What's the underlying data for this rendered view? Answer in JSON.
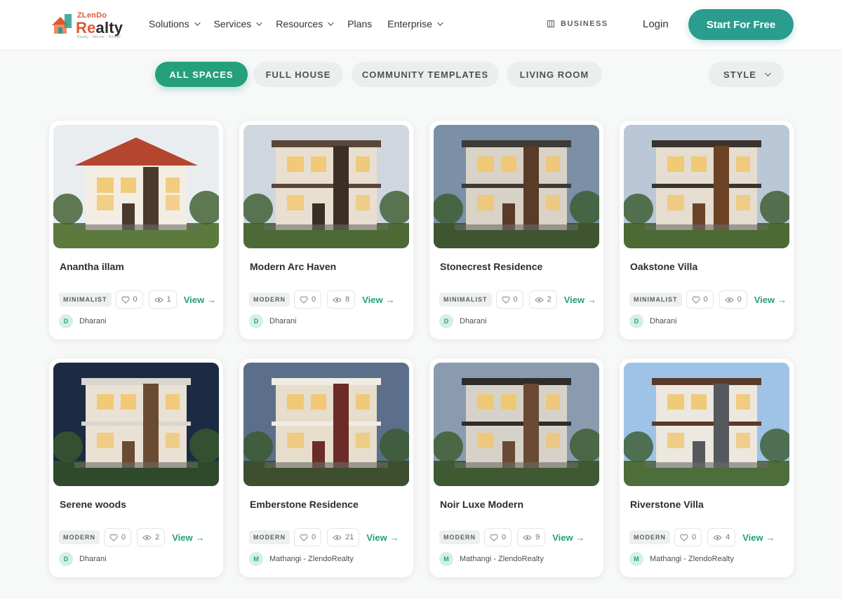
{
  "brand": {
    "top": "ZLenDo",
    "main_a": "Re",
    "main_b": "alty",
    "tag": "Realty · Interior · Builder"
  },
  "nav": [
    {
      "label": "Solutions",
      "has_menu": true
    },
    {
      "label": "Services",
      "has_menu": true
    },
    {
      "label": "Resources",
      "has_menu": true
    },
    {
      "label": "Plans",
      "has_menu": false
    },
    {
      "label": "Enterprise",
      "has_menu": true
    }
  ],
  "header": {
    "business": "BUSINESS",
    "login": "Login",
    "cta": "Start For Free"
  },
  "filters": {
    "chips": [
      "ALL SPACES",
      "FULL HOUSE",
      "COMMUNITY TEMPLATES",
      "LIVING ROOM"
    ],
    "active": "ALL SPACES",
    "style": "STYLE"
  },
  "view_label": "View",
  "colors": {
    "accent": "#24a07a",
    "cta": "#2a9d8f",
    "brand": "#e4572e"
  },
  "cards": [
    {
      "title": "Anantha illam",
      "tag": "MINIMALIST",
      "likes": "0",
      "views": "1",
      "author": "Dharani",
      "initial": "D"
    },
    {
      "title": "Modern Arc Haven",
      "tag": "MODERN",
      "likes": "0",
      "views": "8",
      "author": "Dharani",
      "initial": "D"
    },
    {
      "title": "Stonecrest Residence",
      "tag": "MINIMALIST",
      "likes": "0",
      "views": "2",
      "author": "Dharani",
      "initial": "D"
    },
    {
      "title": "Oakstone Villa",
      "tag": "MINIMALIST",
      "likes": "0",
      "views": "0",
      "author": "Dharani",
      "initial": "D"
    },
    {
      "title": "Serene woods",
      "tag": "MODERN",
      "likes": "0",
      "views": "2",
      "author": "Dharani",
      "initial": "D"
    },
    {
      "title": "Emberstone Residence",
      "tag": "MODERN",
      "likes": "0",
      "views": "21",
      "author": "Mathangi - ZlendoRealty",
      "initial": "M"
    },
    {
      "title": "Noir Luxe Modern",
      "tag": "MODERN",
      "likes": "0",
      "views": "9",
      "author": "Mathangi - ZlendoRealty",
      "initial": "M"
    },
    {
      "title": "Riverstone Villa",
      "tag": "MODERN",
      "likes": "0",
      "views": "4",
      "author": "Mathangi - ZlendoRealty",
      "initial": "M"
    }
  ]
}
